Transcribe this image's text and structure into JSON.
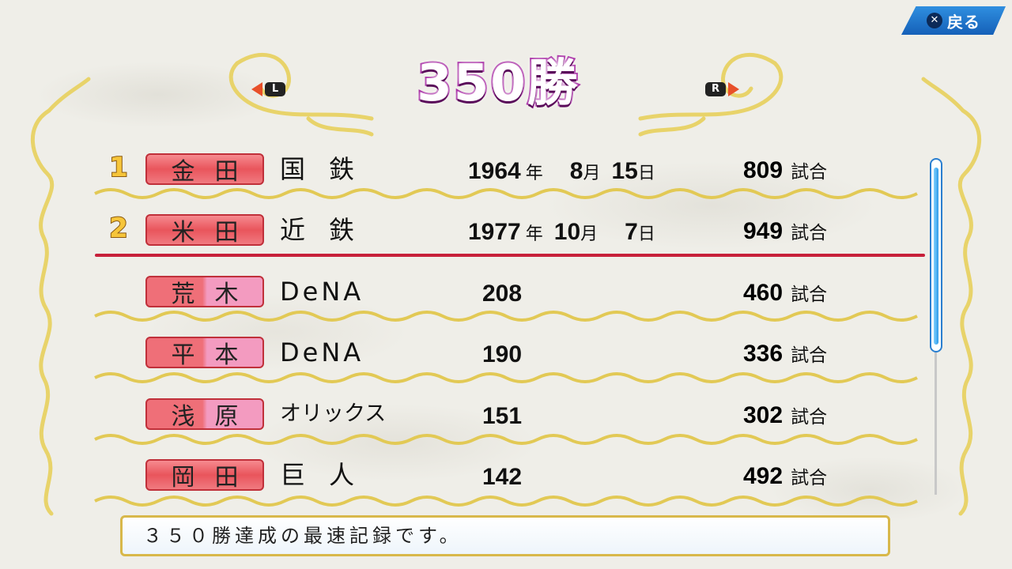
{
  "header": {
    "title": "350勝",
    "back_label": "戻る",
    "back_key_icon": "x-button-icon",
    "nav_left_key": "L",
    "nav_right_key": "R"
  },
  "records": [
    {
      "rank": "1",
      "name": [
        "金",
        "田"
      ],
      "team": "国鉄",
      "year": "1964",
      "year_unit": "年",
      "month": "8",
      "month_unit": "月",
      "day": "15",
      "day_unit": "日",
      "games": "809",
      "games_unit": "試合"
    },
    {
      "rank": "2",
      "name": [
        "米",
        "田"
      ],
      "team": "近鉄",
      "year": "1977",
      "year_unit": "年",
      "month": "10",
      "month_unit": "月",
      "day": "7",
      "day_unit": "日",
      "games": "949",
      "games_unit": "試合"
    },
    {
      "name": [
        "荒",
        "木"
      ],
      "team": "DeNA",
      "wins": "208",
      "games": "460",
      "games_unit": "試合"
    },
    {
      "name": [
        "平",
        "本"
      ],
      "team": "DeNA",
      "wins": "190",
      "games": "336",
      "games_unit": "試合"
    },
    {
      "name": [
        "浅",
        "原"
      ],
      "team": "オリックス",
      "wins": "151",
      "games": "302",
      "games_unit": "試合"
    },
    {
      "name": [
        "岡",
        "田"
      ],
      "team": "巨人",
      "wins": "142",
      "games": "492",
      "games_unit": "試合"
    }
  ],
  "message": "３５０勝達成の最速記録です。",
  "colors": {
    "title_purple": "#a01b9d",
    "name_red": "#e9555c",
    "name_pink": "#f39bc0",
    "divider_red": "#c7203a",
    "gold": "#e8d36a",
    "back_blue": "#1560b8"
  }
}
